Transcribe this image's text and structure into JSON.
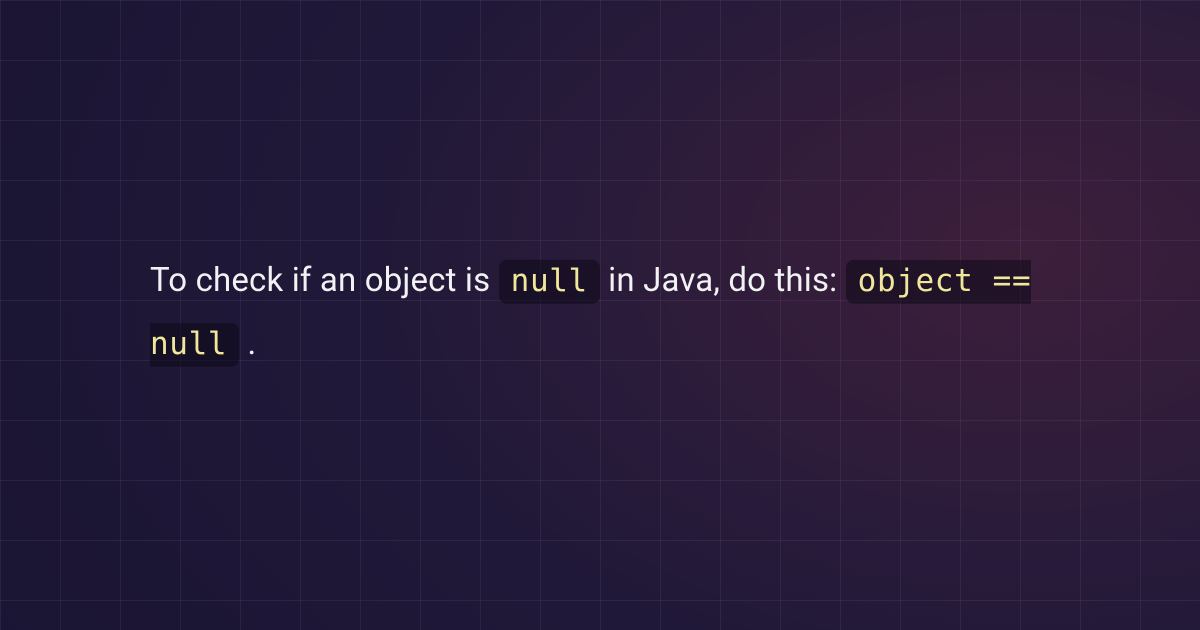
{
  "text": {
    "segment1": "To check if an object is ",
    "code1": "null",
    "segment2": " in Java, do this: ",
    "code2": "object == null",
    "segment3": "."
  }
}
